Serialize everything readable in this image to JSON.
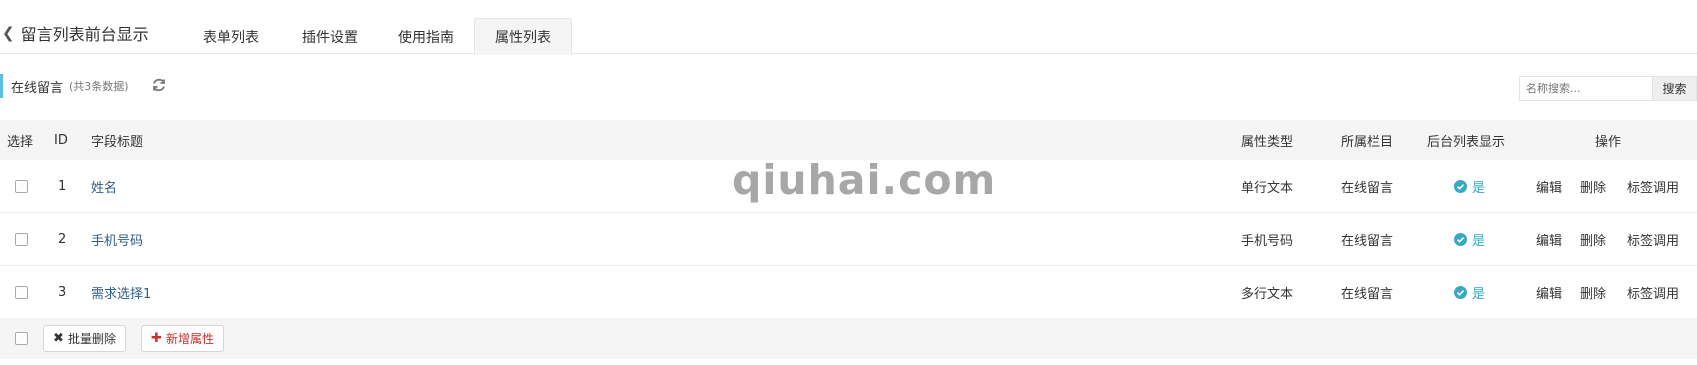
{
  "header": {
    "back_icon": "chevron-left-icon",
    "title": "留言列表前台显示",
    "tabs": [
      {
        "label": "表单列表",
        "active": false
      },
      {
        "label": "插件设置",
        "active": false
      },
      {
        "label": "使用指南",
        "active": false
      },
      {
        "label": "属性列表",
        "active": true
      }
    ]
  },
  "section": {
    "title": "在线留言",
    "count_text": "(共3条数据)",
    "refresh_icon": "refresh-icon"
  },
  "search": {
    "placeholder": "名称搜索...",
    "button_label": "搜索"
  },
  "table": {
    "columns": [
      "选择",
      "ID",
      "字段标题",
      "属性类型",
      "所属栏目",
      "后台列表显示",
      "操作"
    ],
    "rows": [
      {
        "id": "1",
        "title": "姓名",
        "type": "单行文本",
        "column": "在线留言",
        "show": "是",
        "actions": [
          "编辑",
          "删除",
          "标签调用"
        ]
      },
      {
        "id": "2",
        "title": "手机号码",
        "type": "手机号码",
        "column": "在线留言",
        "show": "是",
        "actions": [
          "编辑",
          "删除",
          "标签调用"
        ]
      },
      {
        "id": "3",
        "title": "需求选择1",
        "type": "多行文本",
        "column": "在线留言",
        "show": "是",
        "actions": [
          "编辑",
          "删除",
          "标签调用"
        ]
      }
    ],
    "status_icon": "check-circle-icon"
  },
  "footer": {
    "batch_delete_label": "批量删除",
    "batch_delete_icon": "close-icon",
    "add_label": "新增属性",
    "add_icon": "plus-icon"
  },
  "watermark": "qiuhai.com",
  "colors": {
    "accent": "#5bc0de",
    "status": "#38a9c5",
    "link": "#2d5d8a",
    "add": "#c9302c"
  }
}
